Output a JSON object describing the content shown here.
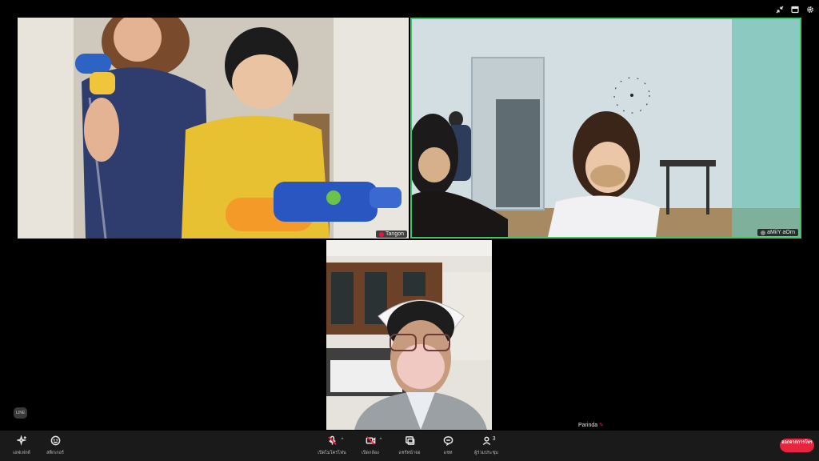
{
  "participants": {
    "tangon": {
      "name": "Tangon"
    },
    "amiy": {
      "name": "aMiiY aOrn"
    },
    "parinda": {
      "name": "Parinda"
    }
  },
  "logo": {
    "text": "LINE"
  },
  "toolbar": {
    "effects_label": "เอฟเฟกต์",
    "stickers_label": "สติกเกอร์",
    "mic_label": "เปิดไมโครโฟน",
    "camera_label": "เปิดกล้อง",
    "share_label": "แชร์หน้าจอ",
    "chat_label": "แชท",
    "members_label": "ผู้ร่วมประชุม",
    "members_count": "3",
    "leave_label": "ออกจากการโทร"
  },
  "colors": {
    "active_speaker_border": "#3ec66a",
    "leave_button": "#e8243f",
    "muted_indicator": "#e8243f"
  },
  "icons": [
    "minimize-icon",
    "layout-icon",
    "settings-icon",
    "effects-icon",
    "sticker-icon",
    "mic-off-icon",
    "camera-off-icon",
    "share-screen-icon",
    "chat-icon",
    "members-icon"
  ]
}
